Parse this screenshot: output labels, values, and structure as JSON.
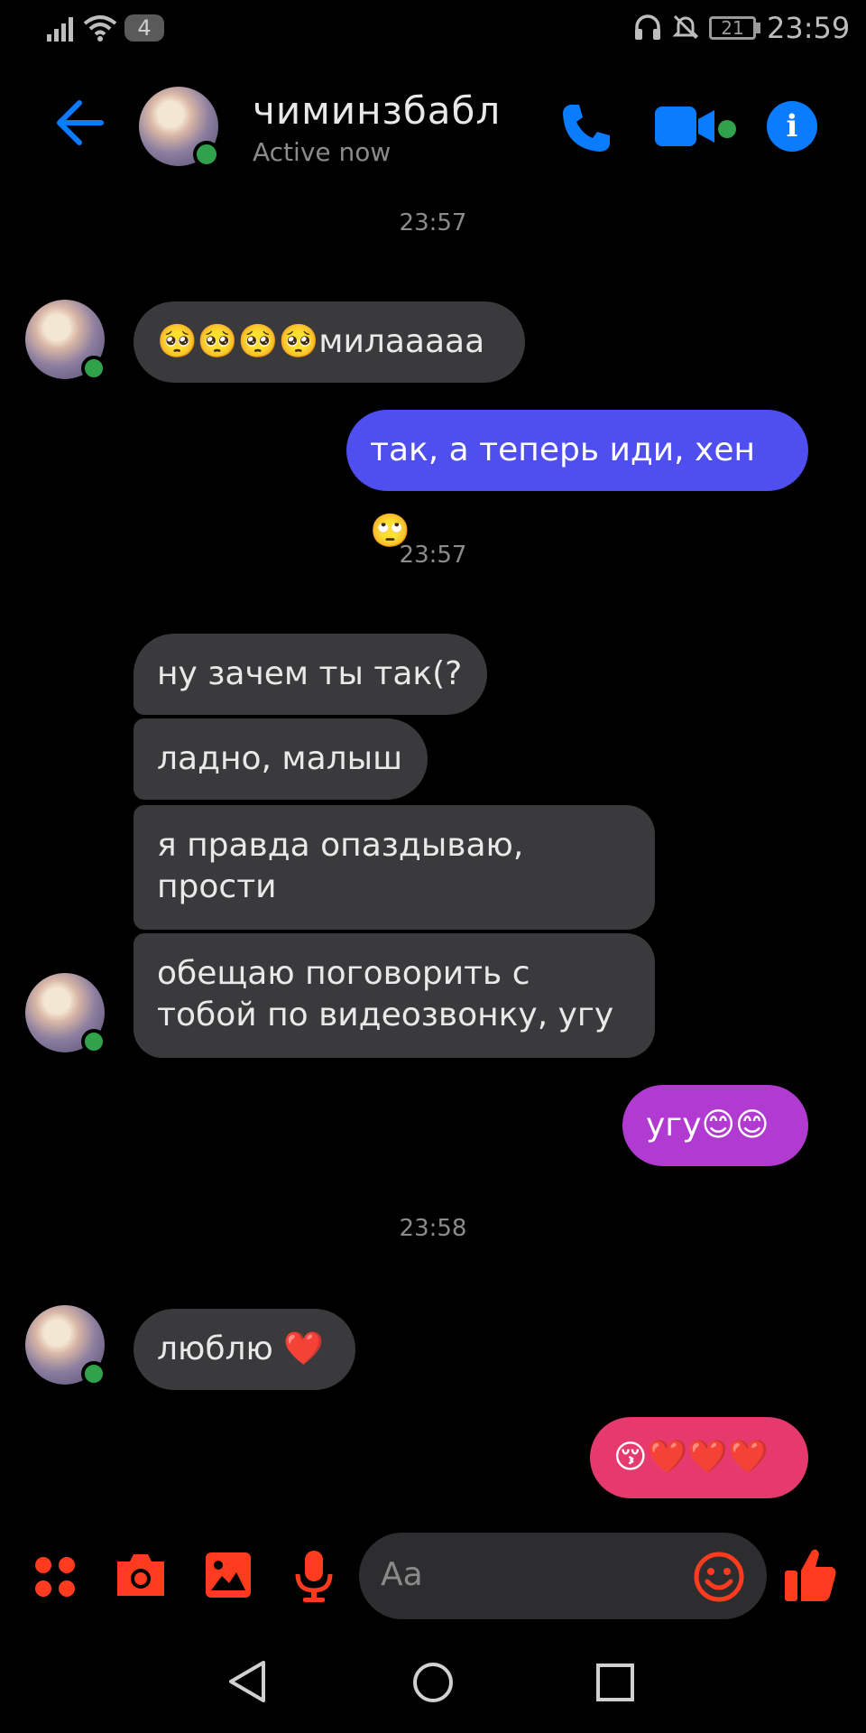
{
  "status_bar": {
    "notification_count": "4",
    "battery": "21",
    "time": "23:59",
    "icons": [
      "signal-icon",
      "wifi-icon",
      "headphones-icon",
      "bell-muted-icon",
      "battery-icon"
    ]
  },
  "header": {
    "contact_name": "чиминзбабл",
    "activity": "Active now",
    "icons": [
      "back-arrow-icon",
      "phone-icon",
      "video-camera-icon",
      "info-icon"
    ],
    "accent_color": "#0a7cff"
  },
  "conversation": {
    "timestamps": [
      "23:57",
      "23:57",
      "23:58"
    ],
    "messages": [
      {
        "from": "contact",
        "text": "🥺🥺🥺🥺милааааа"
      },
      {
        "from": "me",
        "text": "так, а теперь иди, хен🙄"
      },
      {
        "from": "contact",
        "text": "ну зачем ты так(?"
      },
      {
        "from": "contact",
        "text": "ладно, малыш"
      },
      {
        "from": "contact",
        "text": "я правда опаздываю, прости"
      },
      {
        "from": "contact",
        "text": "обещаю поговорить с тобой по видеозвонку, угу"
      },
      {
        "from": "me",
        "text": "угу😊😊"
      },
      {
        "from": "contact",
        "text": "люблю ❤️"
      },
      {
        "from": "me",
        "text": "😚❤️❤️❤️"
      }
    ],
    "bubble_colors": {
      "incoming": "#3a3a3c",
      "outgoing_1": "#4f4ff0",
      "outgoing_2": "#b13bd0",
      "outgoing_3": "#e63a6e"
    }
  },
  "composer": {
    "placeholder": "Aa",
    "icons": [
      "apps-icon",
      "camera-icon",
      "gallery-icon",
      "microphone-icon",
      "emoji-icon",
      "thumbs-up-icon"
    ],
    "accent_color": "#ff3b1f"
  },
  "navigation_bar": {
    "icons": [
      "back-triangle-icon",
      "home-circle-icon",
      "recents-square-icon"
    ]
  }
}
